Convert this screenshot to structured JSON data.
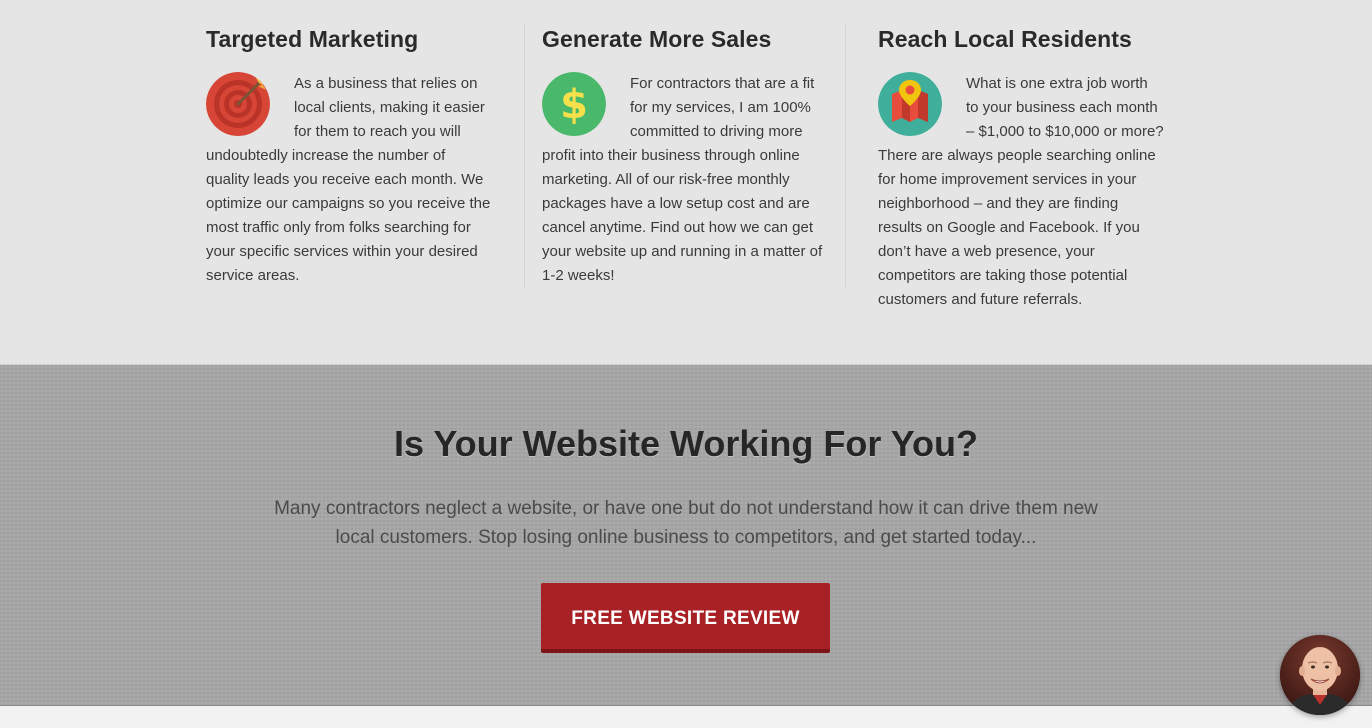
{
  "features": [
    {
      "title": "Targeted Marketing",
      "icon": "target-icon",
      "icon_color": "#d64535",
      "body": "As a business that relies on local clients, making it easier for them to reach you will undoubtedly increase the number of quality leads you receive each month. We optimize our campaigns so you receive the most traffic only from folks searching for your specific services within your desired service areas."
    },
    {
      "title": "Generate More Sales",
      "icon": "dollar-icon",
      "icon_color": "#49b86a",
      "body": "For contractors that are a fit for my services, I am 100% committed to driving more profit into their business through online marketing. All of our risk-free monthly packages have a low setup cost and are cancel anytime. Find out how we can get your website up and running in a matter of 1-2 weeks!"
    },
    {
      "title": "Reach Local Residents",
      "icon": "map-pin-icon",
      "icon_color": "#3fae9a",
      "body": "What is one extra job worth to your business each month – $1,000 to $10,000 or more? There are always people searching online for home improvement services in your neighborhood – and they are finding results on Google and Facebook. If you don’t have a web presence, your competitors are taking those potential customers and future referrals."
    }
  ],
  "cta": {
    "heading": "Is Your Website Working For You?",
    "text": "Many contractors neglect a website, or have one but do not understand how it can drive them new local customers. Stop losing online business to competitors, and get started today...",
    "button_label": "FREE WEBSITE REVIEW",
    "button_color": "#a82124"
  },
  "chat": {
    "avatar_icon": "person-avatar-icon"
  }
}
